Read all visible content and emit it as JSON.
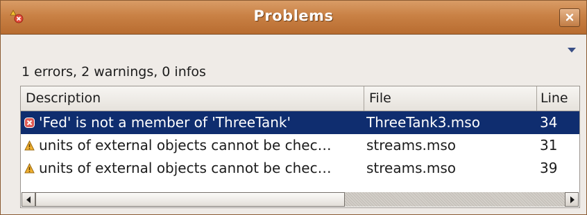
{
  "window": {
    "title": "Problems",
    "app_icon": "problems-view-icon",
    "close_icon": "close-icon"
  },
  "summary": "1 errors, 2 warnings, 0 infos",
  "table": {
    "columns": [
      "Description",
      "File",
      "Line"
    ],
    "rows": [
      {
        "type": "error",
        "icon": "error-icon",
        "description": "'Fed' is not a member of 'ThreeTank'",
        "file": "ThreeTank3.mso",
        "line": "34",
        "selected": true
      },
      {
        "type": "warning",
        "icon": "warning-icon",
        "description": "units of external objects cannot be chec…",
        "file": "streams.mso",
        "line": "31",
        "selected": false
      },
      {
        "type": "warning",
        "icon": "warning-icon",
        "description": "units of external objects cannot be chec…",
        "file": "streams.mso",
        "line": "39",
        "selected": false
      }
    ]
  },
  "colors": {
    "titlebar": "#c98145",
    "selection": "#0f2d6f",
    "error": "#d9302b",
    "warning": "#e8a020"
  }
}
